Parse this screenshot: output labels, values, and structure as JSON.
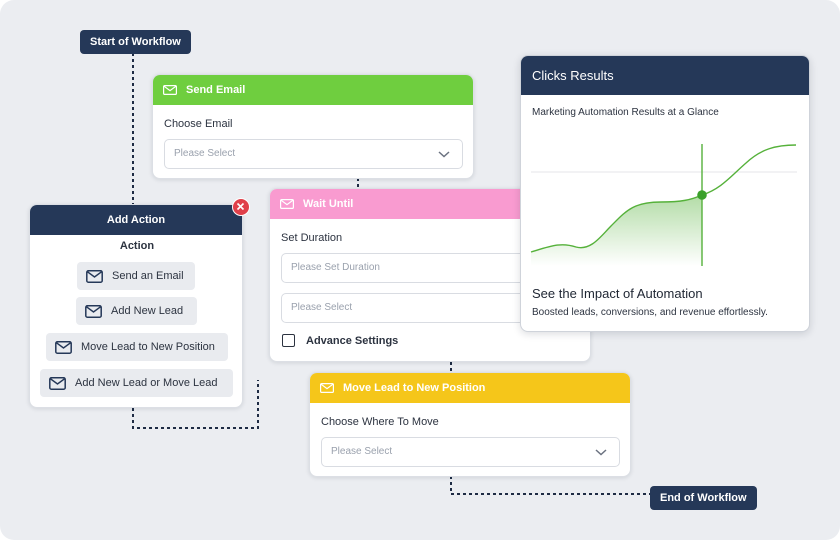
{
  "start_label": "Start of Workflow",
  "end_label": "End of Workflow",
  "send_email": {
    "title": "Send Email",
    "field_label": "Choose Email",
    "placeholder": "Please Select",
    "color": "#6fce3f"
  },
  "wait_until": {
    "title": "Wait Until",
    "field_label": "Set Duration",
    "duration_placeholder": "Please Set Duration",
    "select_placeholder": "Please Select",
    "advance_label": "Advance Settings",
    "color": "#f99bd0"
  },
  "move_lead": {
    "title": "Move Lead to New Position",
    "field_label": "Choose Where To Move",
    "placeholder": "Please Select",
    "color": "#f5c61a"
  },
  "add_action": {
    "title": "Add Action",
    "subtitle": "Action",
    "items": [
      {
        "label": "Send an Email"
      },
      {
        "label": "Add New Lead"
      },
      {
        "label": "Move Lead to New Position"
      },
      {
        "label": "Add New Lead or Move Lead"
      }
    ],
    "close_color": "#e0404a"
  },
  "results": {
    "title": "Clicks Results",
    "subtitle": "Marketing Automation Results at a Glance",
    "headline": "See the Impact of Automation",
    "description": "Boosted leads, conversions, and revenue effortlessly."
  },
  "colors": {
    "header_dark": "#253858",
    "chart_line": "#55b13a"
  }
}
